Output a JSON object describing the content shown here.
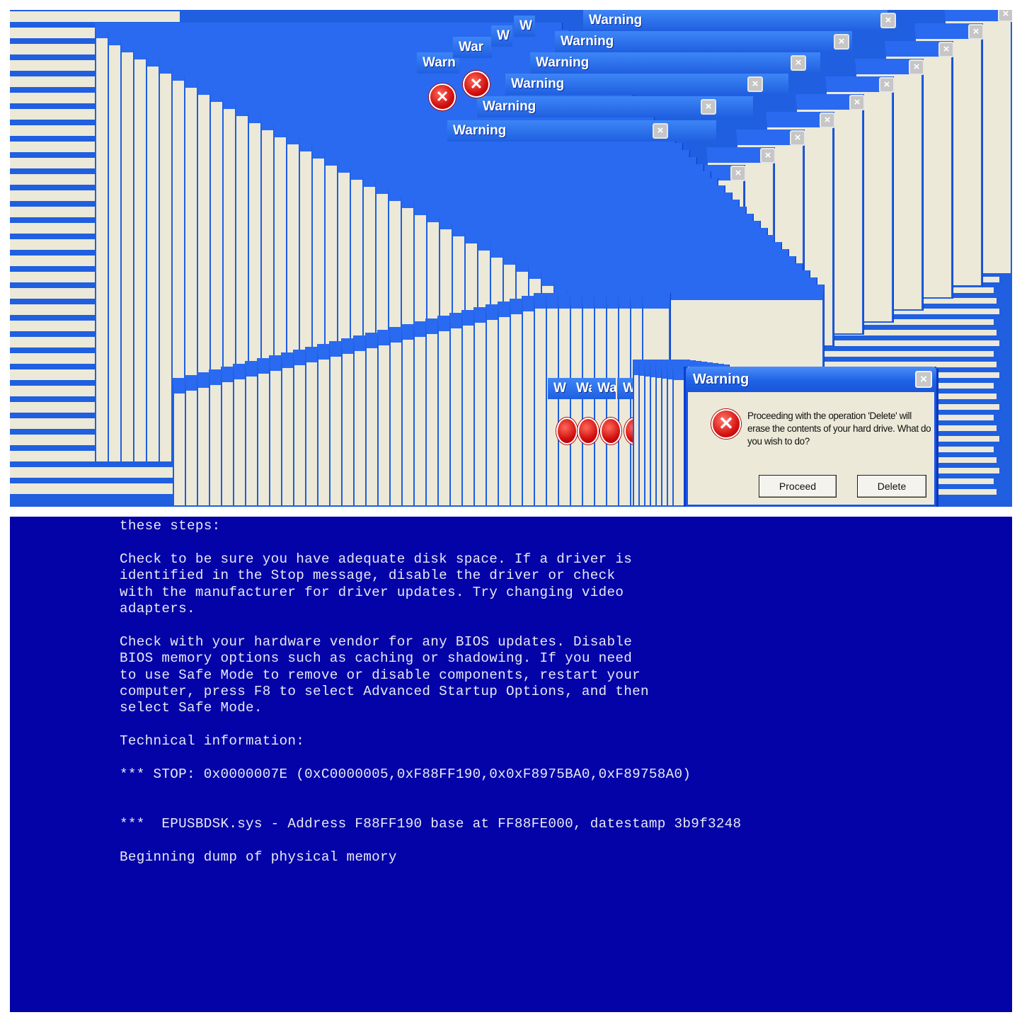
{
  "warning_dialog": {
    "title": "Warning",
    "close_glyph": "×",
    "icon": "error-icon",
    "message": "Proceeding with the operation 'Delete' will erase the contents of your hard drive. What do you wish to do?",
    "buttons": {
      "proceed": "Proceed",
      "delete": "Delete"
    }
  },
  "cascade": {
    "titles": [
      "Warning",
      "Warning",
      "Warning",
      "Warning",
      "Warning",
      "Warn",
      "War",
      "Warning",
      "W",
      "W",
      "Wa",
      "W",
      "W",
      "Wa"
    ],
    "body_fragment": "will",
    "colors": {
      "title_bar": "#1f5fe0",
      "dialog_face": "#ece9d8",
      "error_red": "#d10f0f"
    }
  },
  "bsod": {
    "background": "#0303a8",
    "text_color": "#e9e9f4",
    "lines": [
      "these steps:",
      "",
      "Check to be sure you have adequate disk space. If a driver is",
      "identified in the Stop message, disable the driver or check",
      "with the manufacturer for driver updates. Try changing video",
      "adapters.",
      "",
      "Check with your hardware vendor for any BIOS updates. Disable",
      "BIOS memory options such as caching or shadowing. If you need",
      "to use Safe Mode to remove or disable components, restart your",
      "computer, press F8 to select Advanced Startup Options, and then",
      "select Safe Mode.",
      "",
      "Technical information:",
      "",
      "*** STOP: 0x0000007E (0xC0000005,0xF88FF190,0x0xF8975BA0,0xF89758A0)",
      "",
      "",
      "***  EPUSBDSK.sys - Address F88FF190 base at FF88FE000, datestamp 3b9f3248",
      "",
      "Beginning dump of physical memory"
    ]
  }
}
